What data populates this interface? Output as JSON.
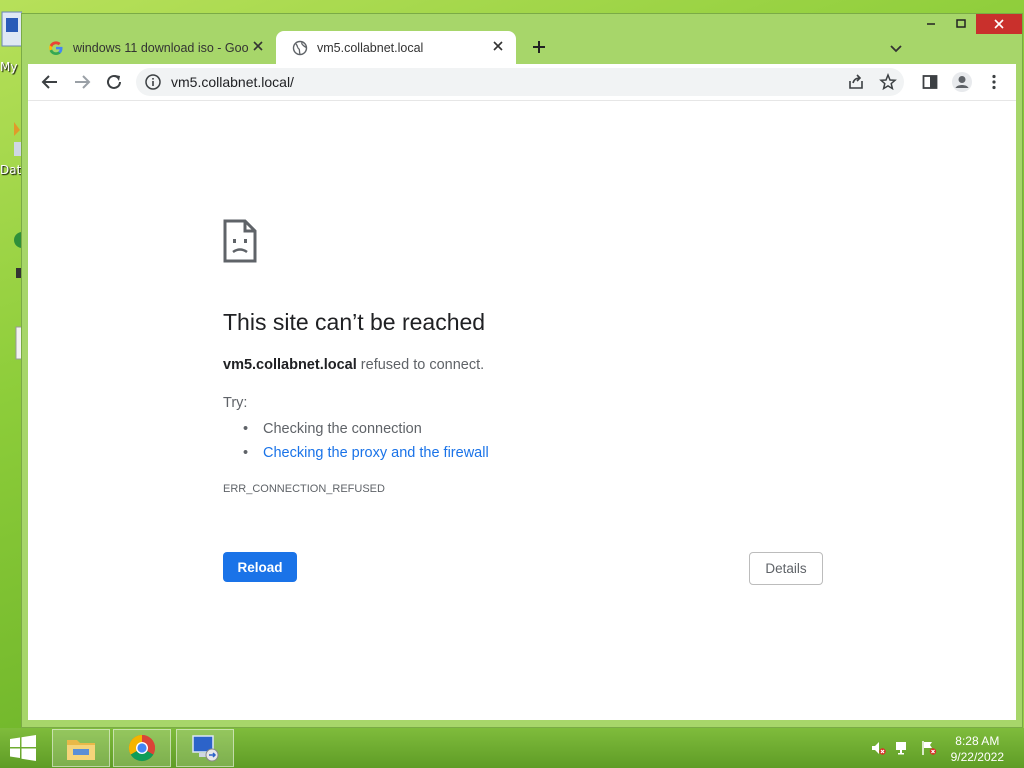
{
  "desktop": {
    "labels": [
      "My",
      "Dat"
    ]
  },
  "browser": {
    "tabs": [
      {
        "title": "windows 11 download iso - Goo",
        "favicon": "google-g-icon",
        "active": false
      },
      {
        "title": "vm5.collabnet.local",
        "favicon": "globe-icon",
        "active": true
      }
    ],
    "url": "vm5.collabnet.local/"
  },
  "error": {
    "title": "This site can’t be reached",
    "host": "vm5.collabnet.local",
    "message": " refused to connect.",
    "try_label": "Try:",
    "suggestions": [
      "Checking the connection",
      "Checking the proxy and the firewall"
    ],
    "code": "ERR_CONNECTION_REFUSED",
    "reload_label": "Reload",
    "details_label": "Details"
  },
  "taskbar": {
    "time": "8:28 AM",
    "date": "9/22/2022"
  },
  "colors": {
    "accent_blue": "#1a73e8",
    "taskbar_green": "#6ba82f"
  }
}
